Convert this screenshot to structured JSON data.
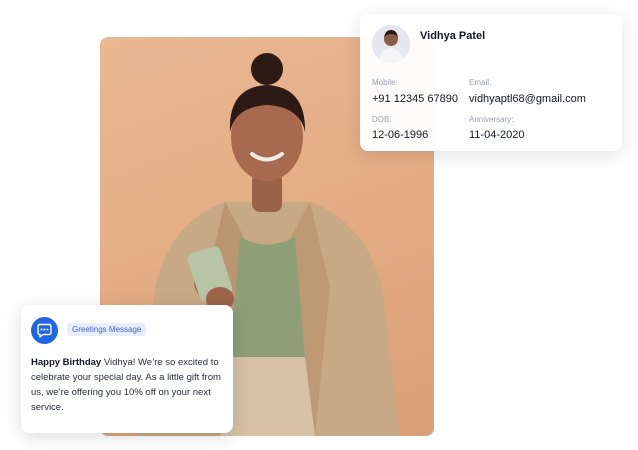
{
  "contact": {
    "name": "Vidhya Patel",
    "mobile_label": "Mobile:",
    "mobile": "+91 12345 67890",
    "email_label": "Email:",
    "email": "vidhyaptl68@gmail.com",
    "dob_label": "DOB:",
    "dob": "12-06-1996",
    "anniversary_label": "Anniversary:",
    "anniversary": "11-04-2020"
  },
  "greeting": {
    "tag": "Greetings Message",
    "message_bold": "Happy Birthday",
    "message_rest": " Vidhya! We’re so excited to celebrate your special day. As a little gift from us, we’re offering you 10% off on your next service."
  },
  "icons": {
    "chat": "chat-bubble-icon",
    "avatar": "user-avatar"
  },
  "colors": {
    "accent_blue": "#1f66e5",
    "tag_bg": "#e7efff",
    "photo_bg": "#e3ab83"
  }
}
